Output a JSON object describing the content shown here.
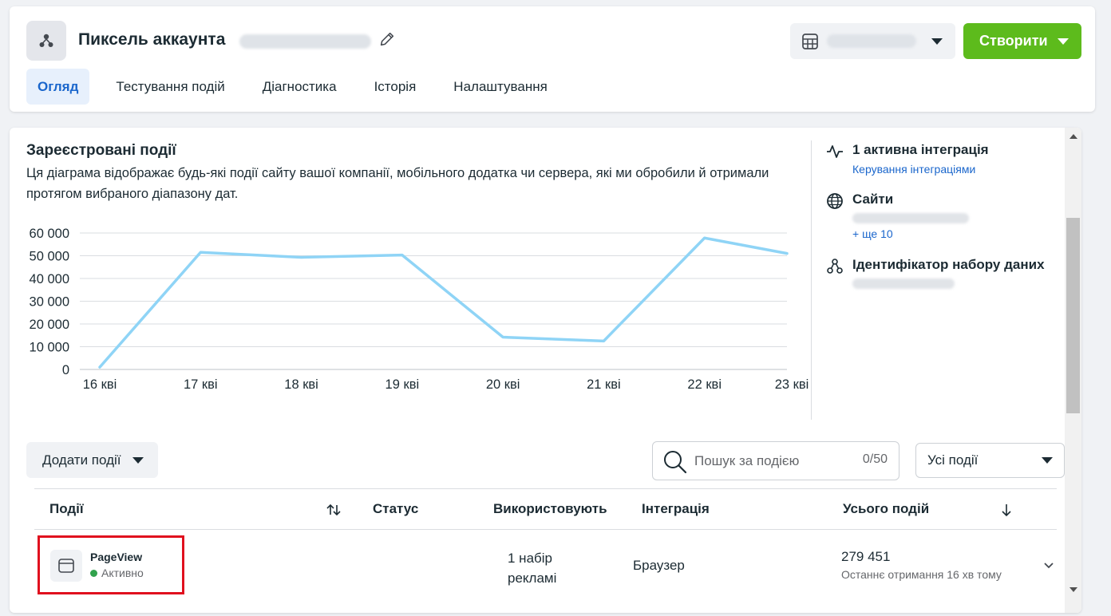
{
  "header": {
    "title": "Пиксель аккаунта",
    "create_label": "Створити"
  },
  "tabs": [
    {
      "label": "Огляд",
      "active": true
    },
    {
      "label": "Тестування подій",
      "active": false
    },
    {
      "label": "Діагностика",
      "active": false
    },
    {
      "label": "Історія",
      "active": false
    },
    {
      "label": "Налаштування",
      "active": false
    }
  ],
  "chart_section": {
    "title": "Зареєстровані події",
    "description": "Ця діаграма відображає будь-які події сайту вашої компанії, мобільного додатка чи сервера, які ми обробили й отримали протягом вибраного діапазону дат."
  },
  "chart_data": {
    "type": "line",
    "categories": [
      "16 кві",
      "17 кві",
      "18 кві",
      "19 кві",
      "20 кві",
      "21 кві",
      "22 кві",
      "23 кві"
    ],
    "values": [
      1000,
      51500,
      49300,
      50300,
      14200,
      12500,
      57800,
      51000
    ],
    "ylim": [
      0,
      60000
    ],
    "yticks": [
      "0",
      "10 000",
      "20 000",
      "30 000",
      "40 000",
      "50 000",
      "60 000"
    ],
    "grid": true,
    "color": "#8fd4f6"
  },
  "side": {
    "integration_title": "1 активна інтеграція",
    "integration_link": "Керування інтеграціями",
    "sites_title": "Сайти",
    "sites_more": "+ ще 10",
    "dataset_title": "Ідентифікатор набору даних"
  },
  "controls": {
    "add_events": "Додати події",
    "search_placeholder": "Пошук за подією",
    "search_counter": "0/50",
    "filter_label": "Усі події"
  },
  "table": {
    "columns": [
      "Події",
      "Статус",
      "Використовують",
      "Інтеграція",
      "Усього подій"
    ],
    "rows": [
      {
        "name": "PageView",
        "status": "Активно",
        "used_by": "1 набір рекламі",
        "integration": "Браузер",
        "total": "279 451",
        "last_received": "Останнє отримання 16 хв тому"
      }
    ]
  },
  "colors": {
    "accent_blue": "#1a66cc",
    "create_green": "#5dbb1c",
    "highlight_red": "#e0101e",
    "status_green": "#31a24c"
  }
}
